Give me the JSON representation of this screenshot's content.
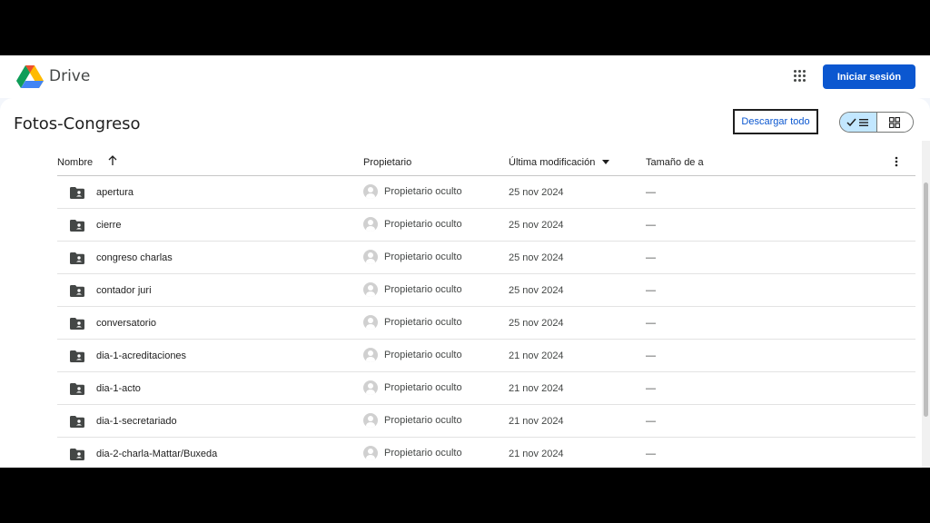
{
  "header": {
    "brand": "Drive",
    "signin_label": "Iniciar sesión"
  },
  "toolbar": {
    "folder_title": "Fotos-Congreso",
    "download_label": "Descargar todo"
  },
  "table": {
    "columns": {
      "name": "Nombre",
      "owner": "Propietario",
      "modified": "Última modificación",
      "size": "Tamaño de a"
    },
    "rows": [
      {
        "name": "apertura",
        "owner": "Propietario oculto",
        "modified": "25 nov 2024",
        "size": "—"
      },
      {
        "name": "cierre",
        "owner": "Propietario oculto",
        "modified": "25 nov 2024",
        "size": "—"
      },
      {
        "name": "congreso charlas",
        "owner": "Propietario oculto",
        "modified": "25 nov 2024",
        "size": "—"
      },
      {
        "name": "contador juri",
        "owner": "Propietario oculto",
        "modified": "25 nov 2024",
        "size": "—"
      },
      {
        "name": "conversatorio",
        "owner": "Propietario oculto",
        "modified": "25 nov 2024",
        "size": "—"
      },
      {
        "name": "dia-1-acreditaciones",
        "owner": "Propietario oculto",
        "modified": "21 nov 2024",
        "size": "—"
      },
      {
        "name": "dia-1-acto",
        "owner": "Propietario oculto",
        "modified": "21 nov 2024",
        "size": "—"
      },
      {
        "name": "dia-1-secretariado",
        "owner": "Propietario oculto",
        "modified": "21 nov 2024",
        "size": "—"
      },
      {
        "name": "dia-2-charla-Mattar/Buxeda",
        "owner": "Propietario oculto",
        "modified": "21 nov 2024",
        "size": "—"
      }
    ]
  },
  "colors": {
    "accent": "#0b57d0",
    "toggle_selected": "#c2e7ff"
  },
  "icons": {
    "logo": "google-drive-logo",
    "apps": "apps-grid-icon",
    "sort": "arrow-up-icon",
    "sort_dropdown": "caret-down-icon",
    "more": "more-vert-icon",
    "folder": "shared-folder-icon",
    "owner": "avatar-icon"
  }
}
